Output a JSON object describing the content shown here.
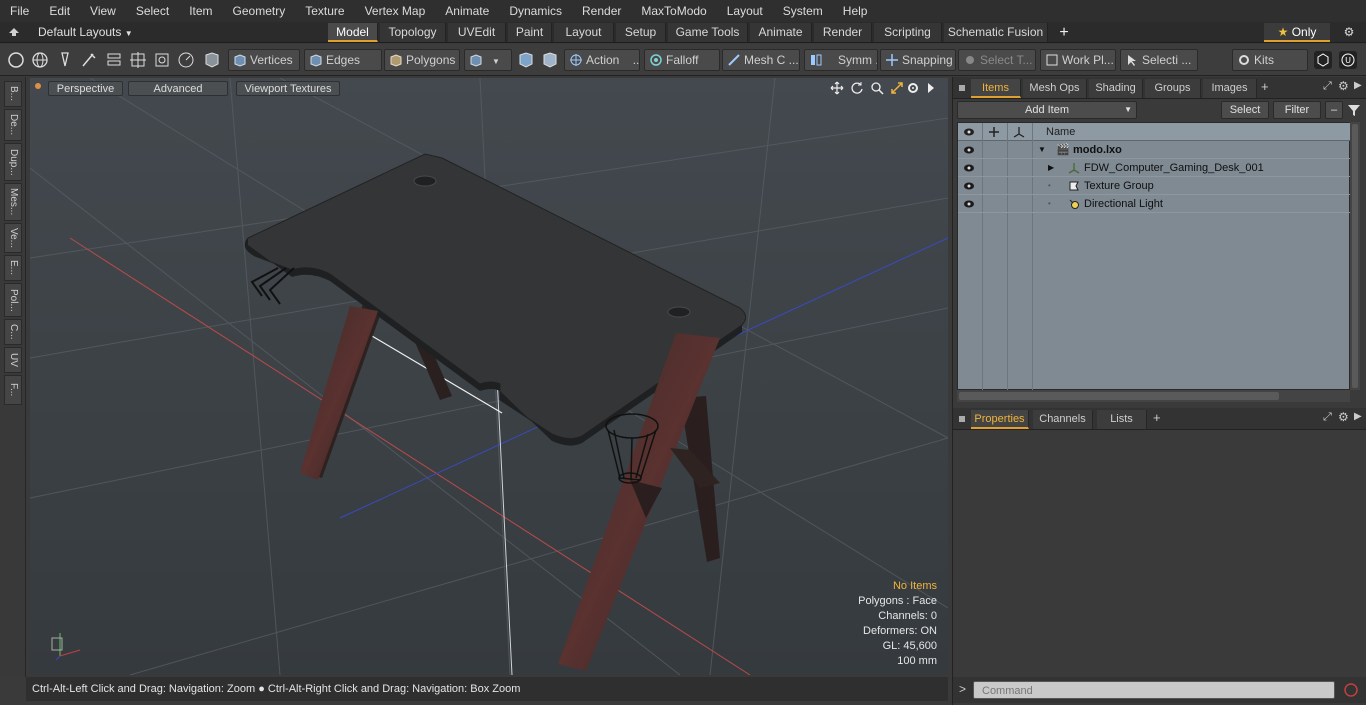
{
  "menu": [
    "File",
    "Edit",
    "View",
    "Select",
    "Item",
    "Geometry",
    "Texture",
    "Vertex Map",
    "Animate",
    "Dynamics",
    "Render",
    "MaxToModo",
    "Layout",
    "System",
    "Help"
  ],
  "layouts": {
    "label": "Default Layouts",
    "tabs": [
      "Model",
      "Topology",
      "UVEdit",
      "Paint",
      "Layout",
      "Setup",
      "Game Tools",
      "Animate",
      "Render",
      "Scripting",
      "Schematic Fusion"
    ],
    "active_tab": "Model",
    "plus": "+",
    "only_label": "Only",
    "only_star": "★"
  },
  "toolbar": {
    "vertices": "Vertices",
    "edges": "Edges",
    "polygons": "Polygons",
    "action": "Action",
    "action_more": "...",
    "falloff": "Falloff",
    "mesh_c": "Mesh C ...",
    "symm": "Symm ...",
    "snapping": "Snapping",
    "select_t": "Select T...",
    "work_pl": "Work Pl...",
    "selecti": "Selecti ...",
    "kits": "Kits"
  },
  "left_strip": [
    "B...",
    "De...",
    "Dup...",
    "Mes...",
    "Ve...",
    "E...",
    "Pol...",
    "C...",
    "UV",
    "F..."
  ],
  "viewport": {
    "view_mode": "Perspective",
    "advanced": "Advanced",
    "textures": "Viewport Textures",
    "info": {
      "items": "No Items",
      "polygons": "Polygons : Face",
      "channels": "Channels: 0",
      "deformers": "Deformers: ON",
      "gl": "GL: 45,600",
      "scale": "100 mm"
    }
  },
  "status": {
    "left": "Ctrl-Alt-Left Click and Drag: Navigation: Zoom",
    "right": "Ctrl-Alt-Right Click and Drag: Navigation: Box Zoom"
  },
  "items_panel": {
    "tabs": [
      "Items",
      "Mesh Ops",
      "Shading",
      "Groups",
      "Images"
    ],
    "active_tab": "Items",
    "add_item": "Add Item",
    "select": "Select",
    "filter": "Filter",
    "column_name": "Name",
    "tree": [
      {
        "label": "modo.lxo",
        "bold": true
      },
      {
        "label": "FDW_Computer_Gaming_Desk_001"
      },
      {
        "label": "Texture Group"
      },
      {
        "label": "Directional Light"
      }
    ]
  },
  "properties_panel": {
    "tabs": [
      "Properties",
      "Channels",
      "Lists"
    ],
    "active_tab": "Properties"
  },
  "command": {
    "placeholder": "Command",
    "prompt": ">"
  }
}
